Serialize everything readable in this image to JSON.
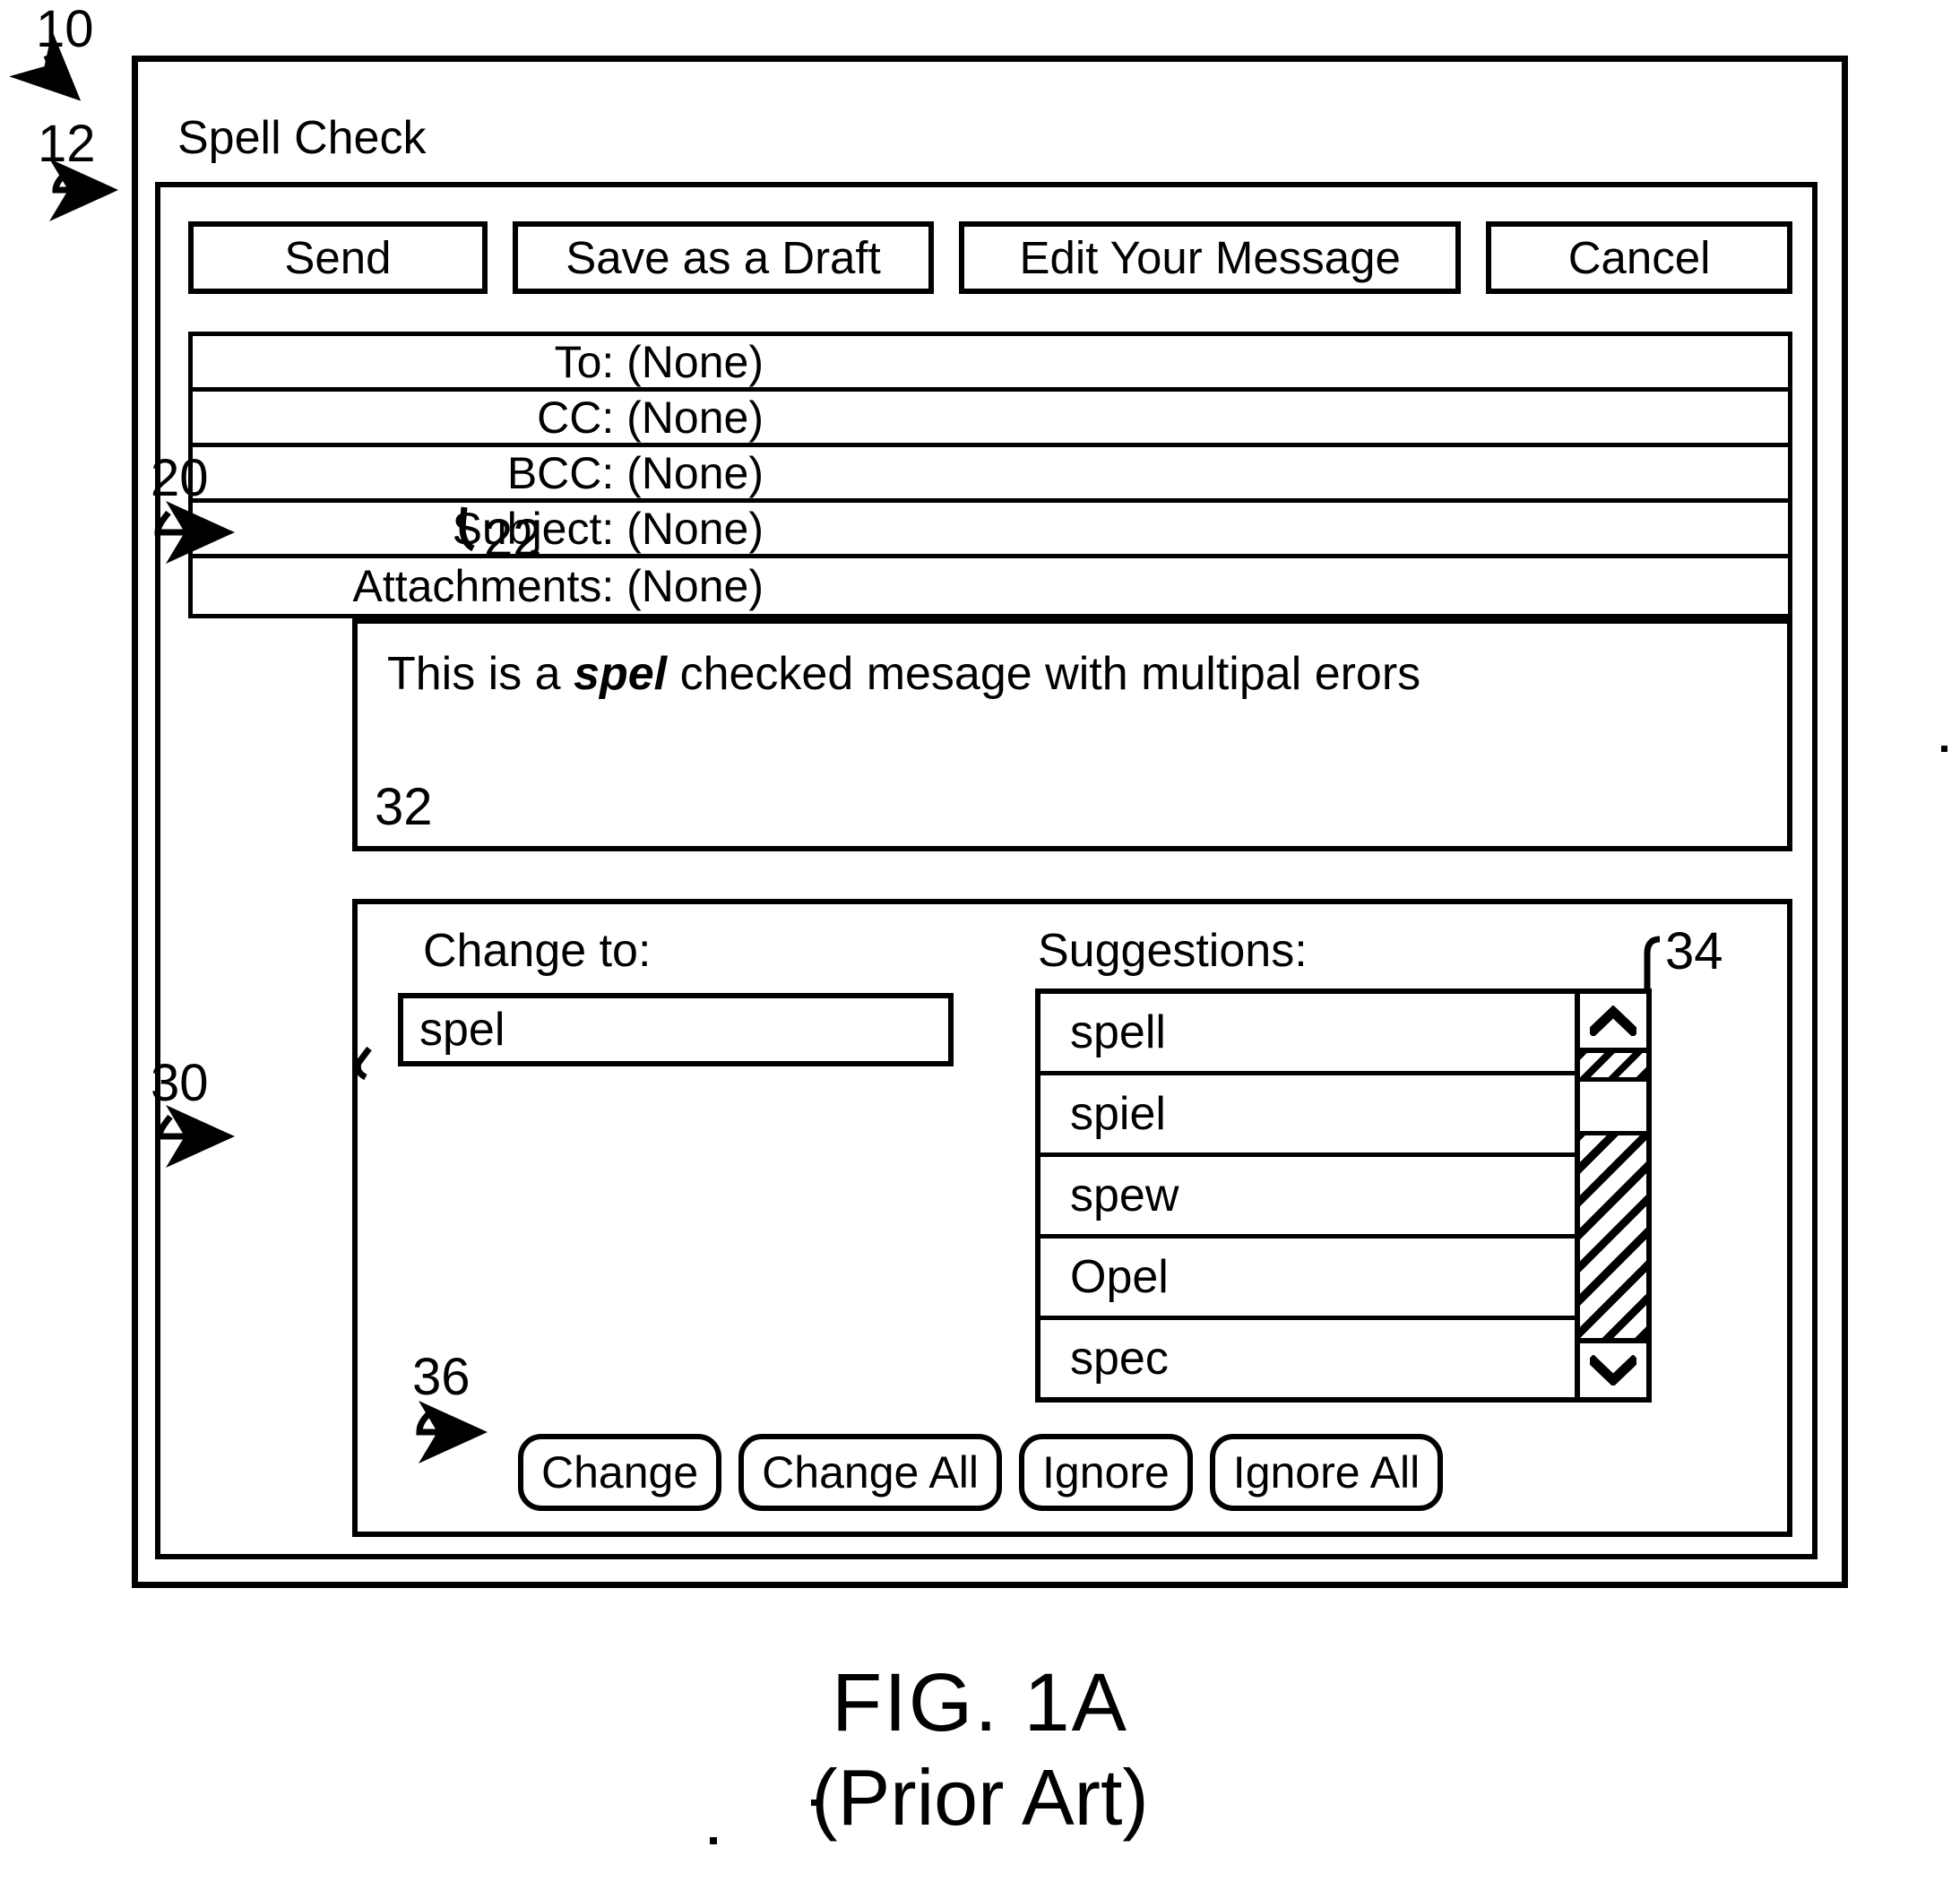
{
  "figure": {
    "title": "FIG. 1A",
    "subtitle": "(Prior Art)"
  },
  "reference_numerals": {
    "window": "10",
    "toolbar": "12",
    "message_body": "20",
    "misspelled_word": "22",
    "spell_panel": "30",
    "change_to_field": "32",
    "suggestions_list": "34",
    "action_buttons": "36"
  },
  "window": {
    "title": "Spell Check"
  },
  "toolbar": {
    "buttons": [
      {
        "label": "Send",
        "name": "send-button"
      },
      {
        "label": "Save as a Draft",
        "name": "save-draft-button"
      },
      {
        "label": "Edit Your Message",
        "name": "edit-message-button"
      },
      {
        "label": "Cancel",
        "name": "cancel-button"
      }
    ]
  },
  "header_fields": [
    {
      "label": "To: (None)"
    },
    {
      "label": "CC: (None)"
    },
    {
      "label": "BCC: (None)"
    },
    {
      "label": "Subject: (None)"
    },
    {
      "label": "Attachments: (None)"
    }
  ],
  "message": {
    "text_before": "This is a ",
    "misspelled_word": "spel",
    "text_after": " checked mesage with multipal erors",
    "full_text": "This is a spel checked mesage with multipal erors"
  },
  "spell_panel": {
    "change_to_label": "Change to:",
    "change_to_value": "spel",
    "suggestions_label": "Suggestions:",
    "suggestions": [
      "spell",
      "spiel",
      "spew",
      "Opel",
      "spec"
    ],
    "scrollbar": {
      "up_arrow_icon": "chevron-up-icon",
      "down_arrow_icon": "chevron-down-icon"
    },
    "action_buttons": [
      {
        "label": "Change",
        "name": "change-button"
      },
      {
        "label": "Change All",
        "name": "change-all-button"
      },
      {
        "label": "Ignore",
        "name": "ignore-button"
      },
      {
        "label": "Ignore All",
        "name": "ignore-all-button"
      }
    ]
  },
  "colors": {
    "ink": "#000000",
    "paper": "#ffffff"
  }
}
